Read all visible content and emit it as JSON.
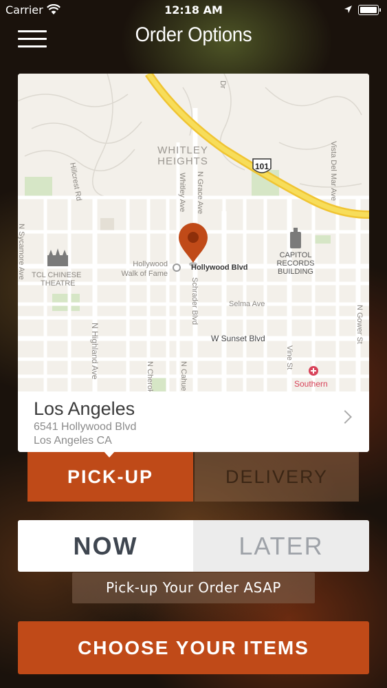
{
  "status_bar": {
    "carrier": "Carrier",
    "time": "12:18 AM"
  },
  "nav": {
    "title": "Order Options"
  },
  "map": {
    "labels": {
      "neighborhood_1": "WHITLEY",
      "neighborhood_2": "HEIGHTS",
      "freeway": "101",
      "hillcrest": "Hillcrest Rd",
      "whitley_ave": "Whitley Ave",
      "grace_ave": "N Grace Ave",
      "vista_del_mar": "Vista Del Mar Ave",
      "sycamore": "N Sycamore Ave",
      "tcl_1": "TCL CHINESE",
      "tcl_2": "THEATRE",
      "walk_1": "Hollywood",
      "walk_2": "Walk of Fame",
      "hollywood_blvd": "Hollywood Blvd",
      "capitol_1": "CAPITOL",
      "capitol_2": "RECORDS",
      "capitol_3": "BUILDING",
      "selma": "Selma Ave",
      "schrader": "Schrader Blvd",
      "gower": "N Gower St",
      "highland": "N Highland Ave",
      "sunset": "W Sunset Blvd",
      "vine": "Vine St",
      "cherokee": "N Cherokee",
      "cahuenga": "N Cahuenga",
      "southern": "Southern",
      "dr": "Dr"
    },
    "colors": {
      "pin": "#c04a18",
      "freeway": "#f5d547"
    }
  },
  "location": {
    "name": "Los Angeles",
    "street": "6541 Hollywood Blvd",
    "city": "Los Angeles CA"
  },
  "fulfillment": {
    "pickup": "PICK-UP",
    "delivery": "DELIVERY",
    "selected": "PICK-UP"
  },
  "timing": {
    "now": "NOW",
    "later": "LATER",
    "selected": "NOW"
  },
  "timing_message": "Pick-up Your Order ASAP",
  "cta": {
    "label": "CHOOSE YOUR ITEMS"
  },
  "accent_color": "#c04a18"
}
